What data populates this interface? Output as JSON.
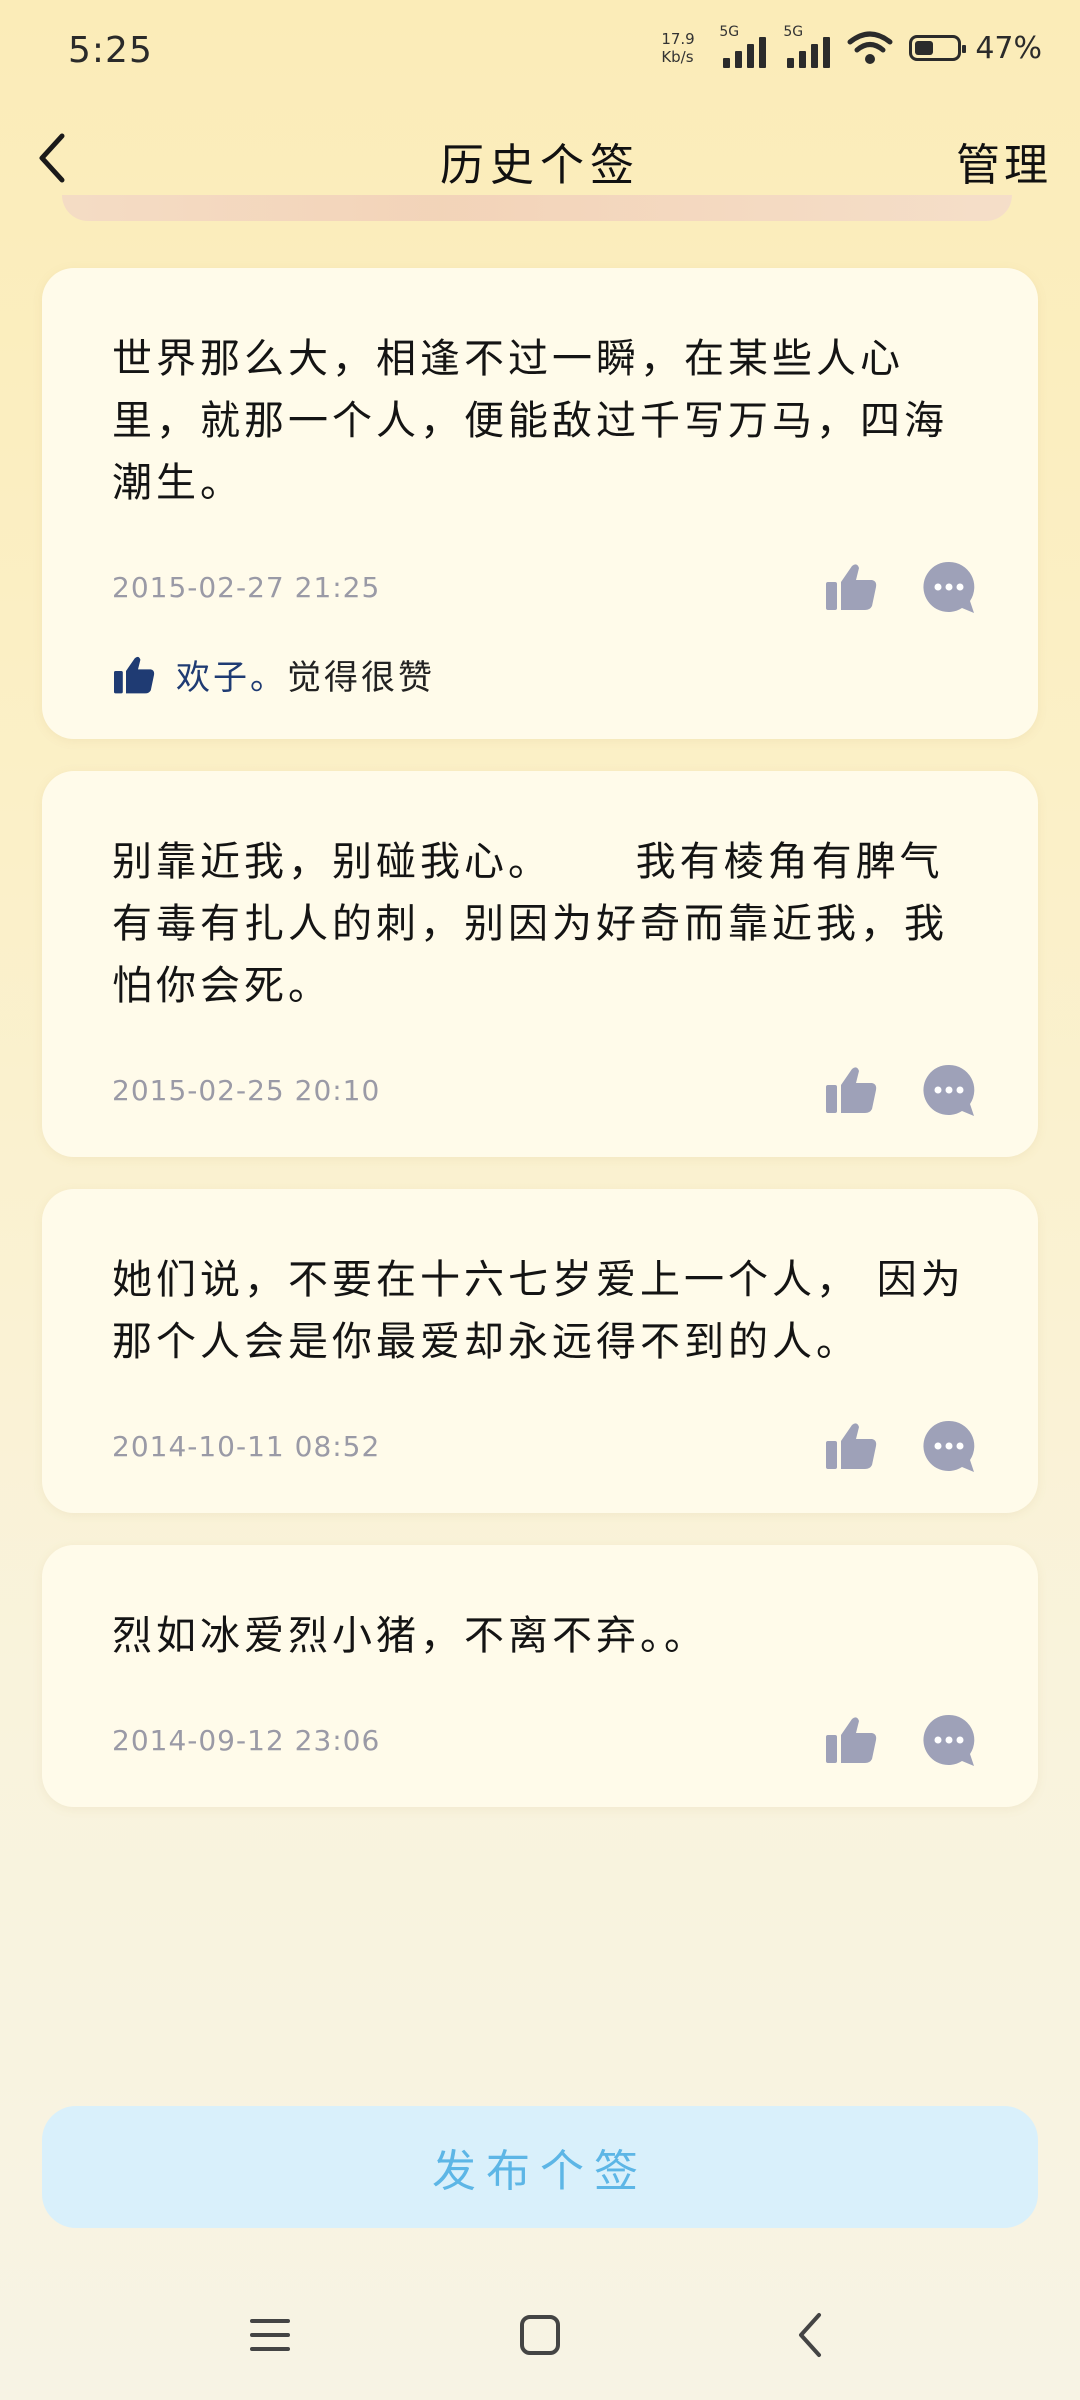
{
  "status": {
    "time": "5:25",
    "speed_top": "17.9",
    "speed_bottom": "Kb/s",
    "sim1": "5G",
    "sim2": "5G",
    "battery": "47%"
  },
  "header": {
    "title": "历史个签",
    "manage": "管理"
  },
  "posts": [
    {
      "text": "世界那么大，相逢不过一瞬，在某些人心里，就那一个人，便能敌过千写万马，四海潮生。",
      "time": "2015-02-27 21:25",
      "liked_by": "欢子。",
      "liked_text": "觉得很赞"
    },
    {
      "text": "别靠近我，别碰我心。     我有棱角有脾气有毒有扎人的刺，别因为好奇而靠近我，我怕你会死。",
      "time": "2015-02-25 20:10"
    },
    {
      "text": "她们说，不要在十六七岁爱上一个人， 因为那个人会是你最爱却永远得不到的人。",
      "time": "2014-10-11 08:52"
    },
    {
      "text": "烈如冰爱烈小猪，不离不弃。。",
      "time": "2014-09-12 23:06"
    }
  ],
  "publish_label": "发布个签",
  "icons": {
    "like": "thumbs-up-icon",
    "comment": "comment-icon",
    "back": "chevron-left-icon"
  },
  "colors": {
    "icon_gray": "#9ea1b8",
    "liked_blue": "#1f3b73",
    "publish_text": "#5db6e6",
    "publish_bg": "#d9f0fb"
  }
}
